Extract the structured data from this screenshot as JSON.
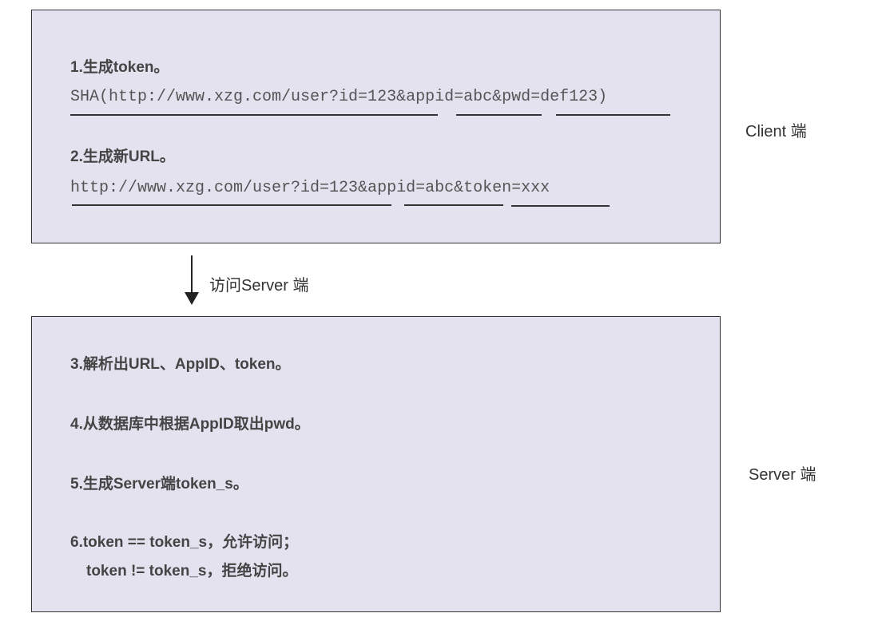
{
  "client": {
    "step1_title": "1.生成token。",
    "step1_code": "SHA(http://www.xzg.com/user?id=123&appid=abc&pwd=def123)",
    "step2_title": "2.生成新URL。",
    "step2_code": "http://www.xzg.com/user?id=123&appid=abc&token=xxx",
    "side_label": "Client 端"
  },
  "arrow": {
    "label": "访问Server 端"
  },
  "server": {
    "step3": "3.解析出URL、AppID、token。",
    "step4": "4.从数据库中根据AppID取出pwd。",
    "step5": "5.生成Server端token_s。",
    "step6_line1": "6.token == token_s，允许访问；",
    "step6_line2": "token != token_s，拒绝访问。",
    "side_label": "Server 端"
  },
  "colors": {
    "box_fill": "#e5e2f0",
    "border": "#333333",
    "text": "#444444"
  }
}
